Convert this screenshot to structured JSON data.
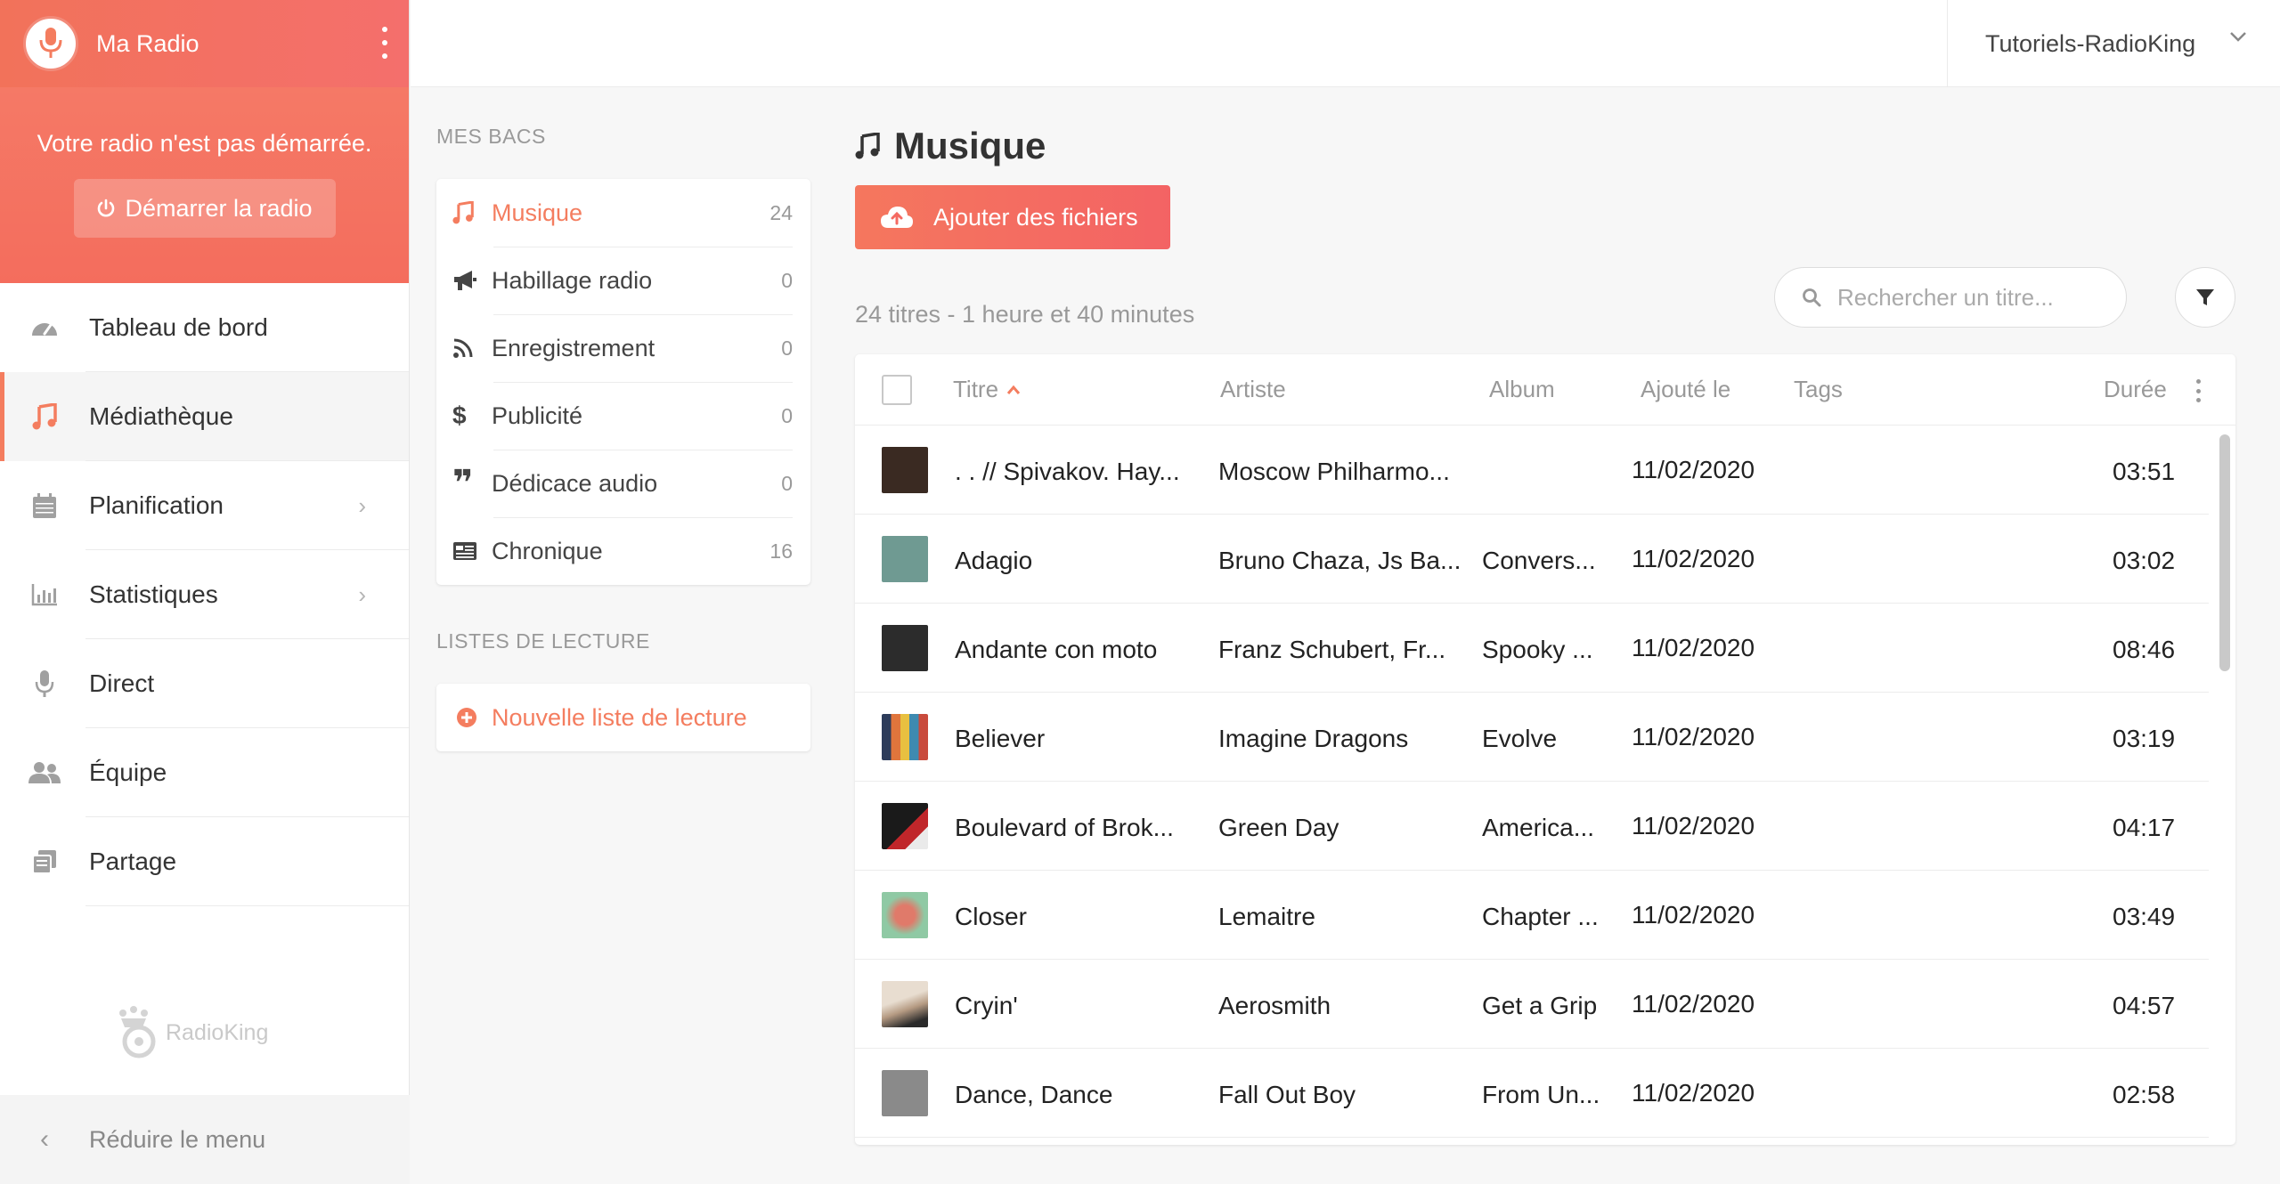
{
  "brand": {
    "name": "Ma Radio"
  },
  "radio": {
    "status": "Votre radio n'est pas démarrée.",
    "start_label": "Démarrer la radio"
  },
  "nav": {
    "items": [
      {
        "label": "Tableau de bord",
        "icon": "dashboard-icon"
      },
      {
        "label": "Médiathèque",
        "icon": "music-note-icon",
        "active": true
      },
      {
        "label": "Planification",
        "icon": "calendar-icon",
        "has_submenu": true
      },
      {
        "label": "Statistiques",
        "icon": "bar-chart-icon",
        "has_submenu": true
      },
      {
        "label": "Direct",
        "icon": "microphone-icon"
      },
      {
        "label": "Équipe",
        "icon": "users-icon"
      },
      {
        "label": "Partage",
        "icon": "share-icon"
      }
    ],
    "reduce_label": "Réduire le menu"
  },
  "footer_logo": {
    "text": "RadioKing"
  },
  "account": {
    "name": "Tutoriels-RadioKing"
  },
  "bins": {
    "title": "MES BACS",
    "items": [
      {
        "label": "Musique",
        "count": "24",
        "icon": "music-note-icon",
        "active": true
      },
      {
        "label": "Habillage radio",
        "count": "0",
        "icon": "megaphone-icon"
      },
      {
        "label": "Enregistrement",
        "count": "0",
        "icon": "rss-icon"
      },
      {
        "label": "Publicité",
        "count": "0",
        "icon": "dollar-icon"
      },
      {
        "label": "Dédicace audio",
        "count": "0",
        "icon": "quote-icon"
      },
      {
        "label": "Chronique",
        "count": "16",
        "icon": "newspaper-icon"
      }
    ]
  },
  "playlists": {
    "title": "LISTES DE LECTURE",
    "new_label": "Nouvelle liste de lecture"
  },
  "main": {
    "title": "Musique",
    "add_label": "Ajouter des fichiers",
    "summary": "24 titres - 1 heure et 40 minutes",
    "search_placeholder": "Rechercher un titre..."
  },
  "table": {
    "headers": {
      "titre": "Titre",
      "artiste": "Artiste",
      "album": "Album",
      "ajoute": "Ajouté le",
      "tags": "Tags",
      "duree": "Durée"
    },
    "rows": [
      {
        "titre": ". . // Spivakov. Hay...",
        "artiste": "Moscow Philharmo...",
        "album": "",
        "date": "11/02/2020",
        "duree": "03:51",
        "cover": "#3a2a22"
      },
      {
        "titre": "Adagio",
        "artiste": "Bruno Chaza, Js Ba...",
        "album": "Convers...",
        "date": "11/02/2020",
        "duree": "03:02",
        "cover": "#6f9a92"
      },
      {
        "titre": "Andante con moto",
        "artiste": "Franz Schubert, Fr...",
        "album": "Spooky ...",
        "date": "11/02/2020",
        "duree": "08:46",
        "cover": "#2c2c2c"
      },
      {
        "titre": "Believer",
        "artiste": "Imagine Dragons",
        "album": "Evolve",
        "date": "11/02/2020",
        "duree": "03:19",
        "cover": "#d86a3c"
      },
      {
        "titre": "Boulevard of Brok...",
        "artiste": "Green Day",
        "album": "America...",
        "date": "11/02/2020",
        "duree": "04:17",
        "cover": "#1a1a1a"
      },
      {
        "titre": "Closer",
        "artiste": "Lemaitre",
        "album": "Chapter ...",
        "date": "11/02/2020",
        "duree": "03:49",
        "cover": "#8fc9a4"
      },
      {
        "titre": "Cryin'",
        "artiste": "Aerosmith",
        "album": "Get a Grip",
        "date": "11/02/2020",
        "duree": "04:57",
        "cover": "#c7b8a6"
      },
      {
        "titre": "Dance, Dance",
        "artiste": "Fall Out Boy",
        "album": "From Un...",
        "date": "11/02/2020",
        "duree": "02:58",
        "cover": "#8a8a8a"
      }
    ]
  },
  "colors": {
    "accent": "#f47d5f",
    "brand_gradient_start": "#f2725a",
    "brand_gradient_end": "#f46f6c"
  }
}
